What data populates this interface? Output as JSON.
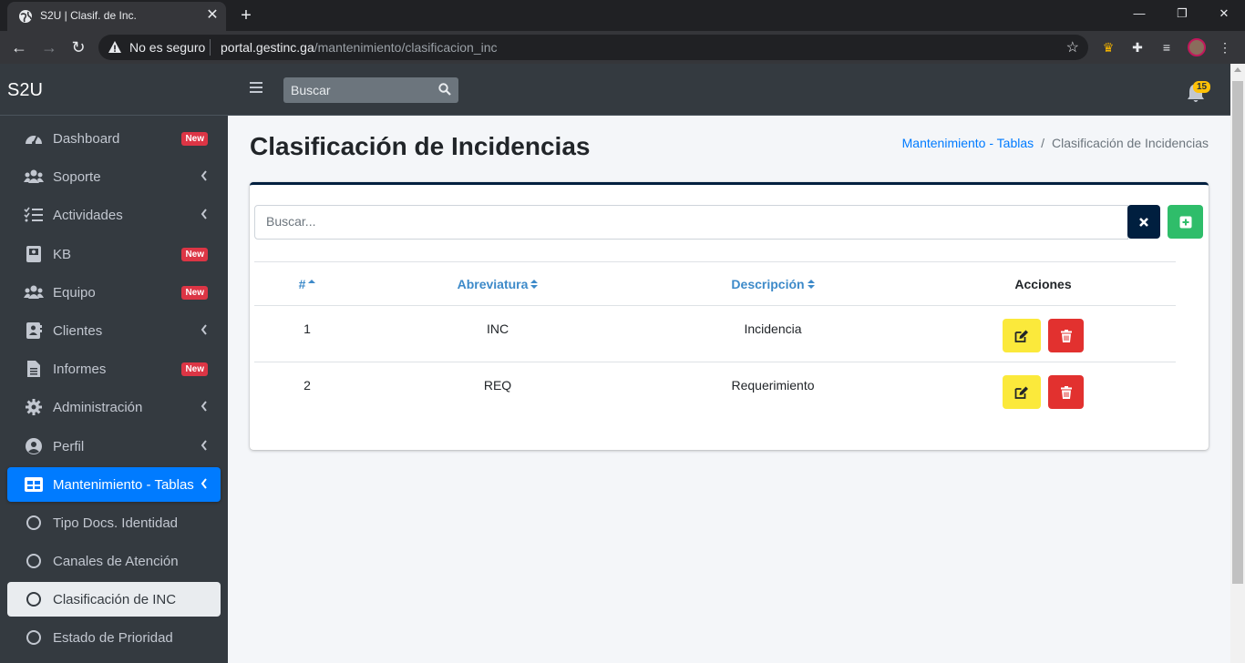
{
  "browser": {
    "tab_title": "S2U | Clasif. de Inc.",
    "security_label": "No es seguro",
    "url_host": "portal.gestinc.ga",
    "url_path": "/mantenimiento/clasificacion_inc"
  },
  "sidebar": {
    "brand": "S2U",
    "items": [
      {
        "label": "Dashboard",
        "icon": "tachometer-icon",
        "badge": "New"
      },
      {
        "label": "Soporte",
        "icon": "users-icon",
        "arrow": true
      },
      {
        "label": "Actividades",
        "icon": "tasks-icon",
        "arrow": true
      },
      {
        "label": "KB",
        "icon": "book-icon",
        "badge": "New"
      },
      {
        "label": "Equipo",
        "icon": "users-icon",
        "badge": "New"
      },
      {
        "label": "Clientes",
        "icon": "address-book-icon",
        "arrow": true
      },
      {
        "label": "Informes",
        "icon": "file-icon",
        "badge": "New"
      },
      {
        "label": "Administración",
        "icon": "gear-icon",
        "arrow": true
      },
      {
        "label": "Perfil",
        "icon": "user-circle-icon",
        "arrow": true
      },
      {
        "label": "Mantenimiento - Tablas",
        "icon": "table-icon",
        "arrow": true,
        "state": "active"
      },
      {
        "label": "Tipo Docs. Identidad",
        "icon": "circle-icon"
      },
      {
        "label": "Canales de Atención",
        "icon": "circle-icon"
      },
      {
        "label": "Clasificación de INC",
        "icon": "circle-icon",
        "state": "current"
      },
      {
        "label": "Estado de Prioridad",
        "icon": "circle-icon"
      }
    ]
  },
  "topbar": {
    "search_placeholder": "Buscar",
    "notifications_count": "15"
  },
  "page": {
    "title": "Clasificación de Incidencias",
    "breadcrumb": [
      "Mantenimiento - Tablas",
      "Clasificación de Incidencias"
    ]
  },
  "card": {
    "search_placeholder": "Buscar...",
    "columns": [
      "#",
      "Abreviatura",
      "Descripción",
      "Acciones"
    ],
    "rows": [
      {
        "id": "1",
        "abbr": "INC",
        "desc": "Incidencia"
      },
      {
        "id": "2",
        "abbr": "REQ",
        "desc": "Requerimiento"
      }
    ]
  },
  "colors": {
    "sidebar_bg": "#343a40",
    "active_blue": "#007bff",
    "badge_red": "#dc3545",
    "card_accent": "#001f3f",
    "add_green": "#2fbd6a",
    "edit_yellow": "#fbe93b",
    "delete_red": "#e2312f"
  }
}
